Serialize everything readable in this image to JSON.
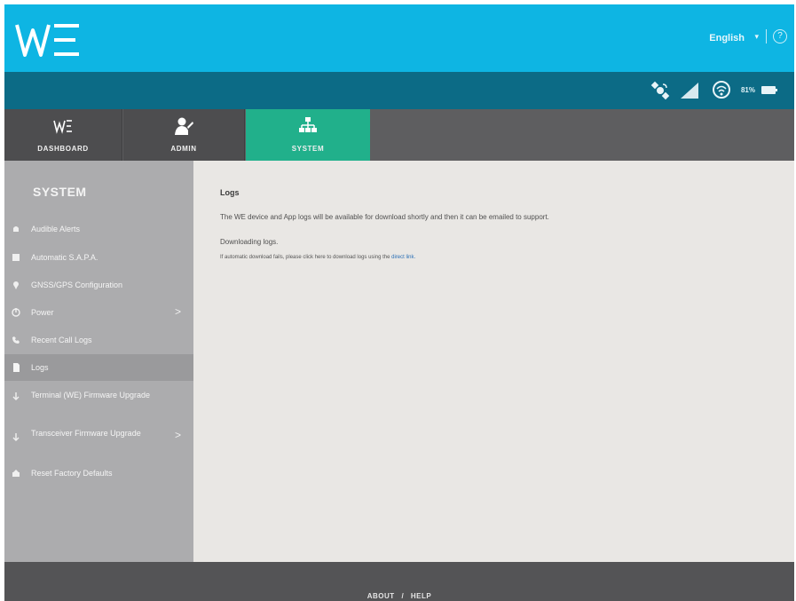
{
  "header": {
    "logo_text": "WE",
    "language": "English",
    "language_arrow": "▾",
    "help_icon": "?",
    "brand_color": "#0eb5e3"
  },
  "status": {
    "battery_percent": "81%",
    "icons": [
      "satellite-icon",
      "signal-icon",
      "wifi-icon",
      "battery-icon"
    ],
    "bar_color": "#0c6b86"
  },
  "tabs": [
    {
      "label": "DASHBOARD",
      "icon": "we-logo-icon",
      "active": false
    },
    {
      "label": "ADMIN",
      "icon": "admin-user-icon",
      "active": false
    },
    {
      "label": "SYSTEM",
      "icon": "network-icon",
      "active": true,
      "color": "#21b08b"
    }
  ],
  "sidebar": {
    "title": "SYSTEM",
    "items": [
      {
        "label": "Audible Alerts",
        "icon": "bell-icon",
        "has_chevron": false,
        "active": false
      },
      {
        "label": "Automatic S.A.P.A.",
        "icon": "sapa-icon",
        "has_chevron": false,
        "active": false
      },
      {
        "label": "GNSS/GPS Configuration",
        "icon": "gps-icon",
        "has_chevron": false,
        "active": false
      },
      {
        "label": "Power",
        "icon": "power-icon",
        "has_chevron": true,
        "active": false
      },
      {
        "label": "Recent Call Logs",
        "icon": "phone-icon",
        "has_chevron": false,
        "active": false
      },
      {
        "label": "Logs",
        "icon": "file-icon",
        "has_chevron": false,
        "active": true
      },
      {
        "label": "Terminal (WE) Firmware Upgrade",
        "icon": "download-icon",
        "has_chevron": false,
        "active": false
      },
      {
        "label": "Transceiver Firmware Upgrade",
        "icon": "download-icon",
        "has_chevron": true,
        "active": false
      },
      {
        "label": "Reset Factory Defaults",
        "icon": "reset-icon",
        "has_chevron": false,
        "active": false
      }
    ],
    "chevron": ">"
  },
  "main": {
    "title": "Logs",
    "description": "The WE device and App logs will be available for download shortly and then it can be emailed to support.",
    "status": "Downloading logs.",
    "note_prefix": "If automatic download fails, please click here to download logs using the",
    "note_link": "direct link."
  },
  "footer": {
    "about": "ABOUT",
    "separator": "/",
    "help": "HELP"
  }
}
